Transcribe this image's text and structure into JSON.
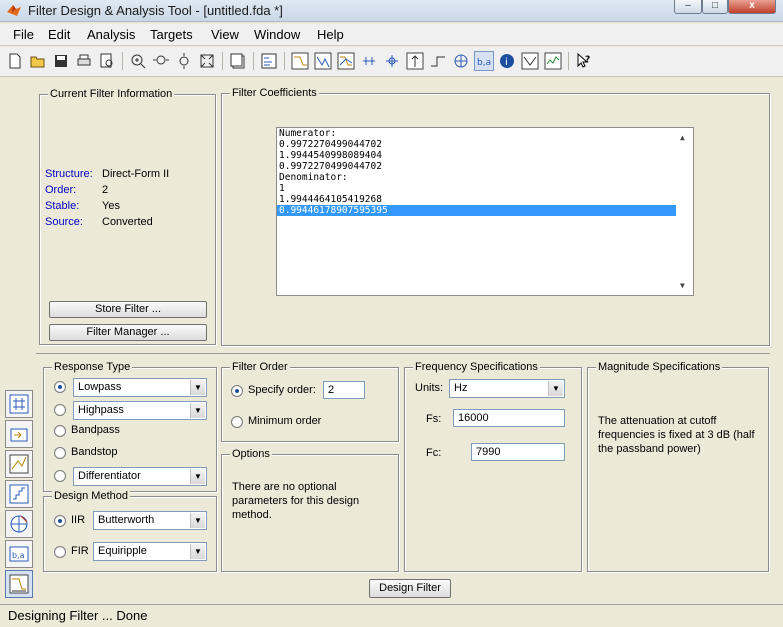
{
  "window": {
    "title": "Filter Design & Analysis Tool -  [untitled.fda *]",
    "minimize_label": "–",
    "maximize_label": "□",
    "close_label": "x"
  },
  "menubar": [
    {
      "label": "File"
    },
    {
      "label": "Edit"
    },
    {
      "label": "Analysis"
    },
    {
      "label": "Targets"
    },
    {
      "label": "View"
    },
    {
      "label": "Window"
    },
    {
      "label": "Help"
    }
  ],
  "current_filter": {
    "title": "Current Filter Information",
    "structure_label": "Structure:",
    "structure_value": "Direct-Form II",
    "order_label": "Order:",
    "order_value": "2",
    "stable_label": "Stable:",
    "stable_value": "Yes",
    "source_label": "Source:",
    "source_value": "Converted",
    "store_button": "Store Filter ...",
    "manager_button": "Filter Manager ..."
  },
  "coefficients": {
    "title": "Filter Coefficients",
    "lines": [
      "Numerator:",
      "0.9972270499044702",
      "1.9944540998089404",
      "0.9972270499044702",
      "Denominator:",
      "1",
      "1.9944464105419268",
      "0.99446178907595395"
    ],
    "selected_index": 7
  },
  "response_type": {
    "title": "Response Type",
    "lowpass": "Lowpass",
    "highpass": "Highpass",
    "bandpass": "Bandpass",
    "bandstop": "Bandstop",
    "differentiator": "Differentiator",
    "selected": "Lowpass"
  },
  "design_method": {
    "title": "Design Method",
    "iir_label": "IIR",
    "iir_value": "Butterworth",
    "fir_label": "FIR",
    "fir_value": "Equiripple",
    "selected": "IIR"
  },
  "filter_order": {
    "title": "Filter Order",
    "specify_label": "Specify order:",
    "specify_value": "2",
    "minimum_label": "Minimum order",
    "selected": "specify"
  },
  "options": {
    "title": "Options",
    "text": "There are no optional parameters for this design method."
  },
  "frequency_specs": {
    "title": "Frequency Specifications",
    "units_label": "Units:",
    "units_value": "Hz",
    "fs_label": "Fs:",
    "fs_value": "16000",
    "fc_label": "Fc:",
    "fc_value": "7990"
  },
  "magnitude_specs": {
    "title": "Magnitude Specifications",
    "text": "The attenuation at cutoff frequencies is fixed at 3 dB (half the passband power)"
  },
  "design_button": "Design Filter",
  "status": "Designing Filter ... Done",
  "colors": {
    "accent": "#3399ff",
    "label_blue": "#0000c8",
    "background": "#ece9d8"
  }
}
